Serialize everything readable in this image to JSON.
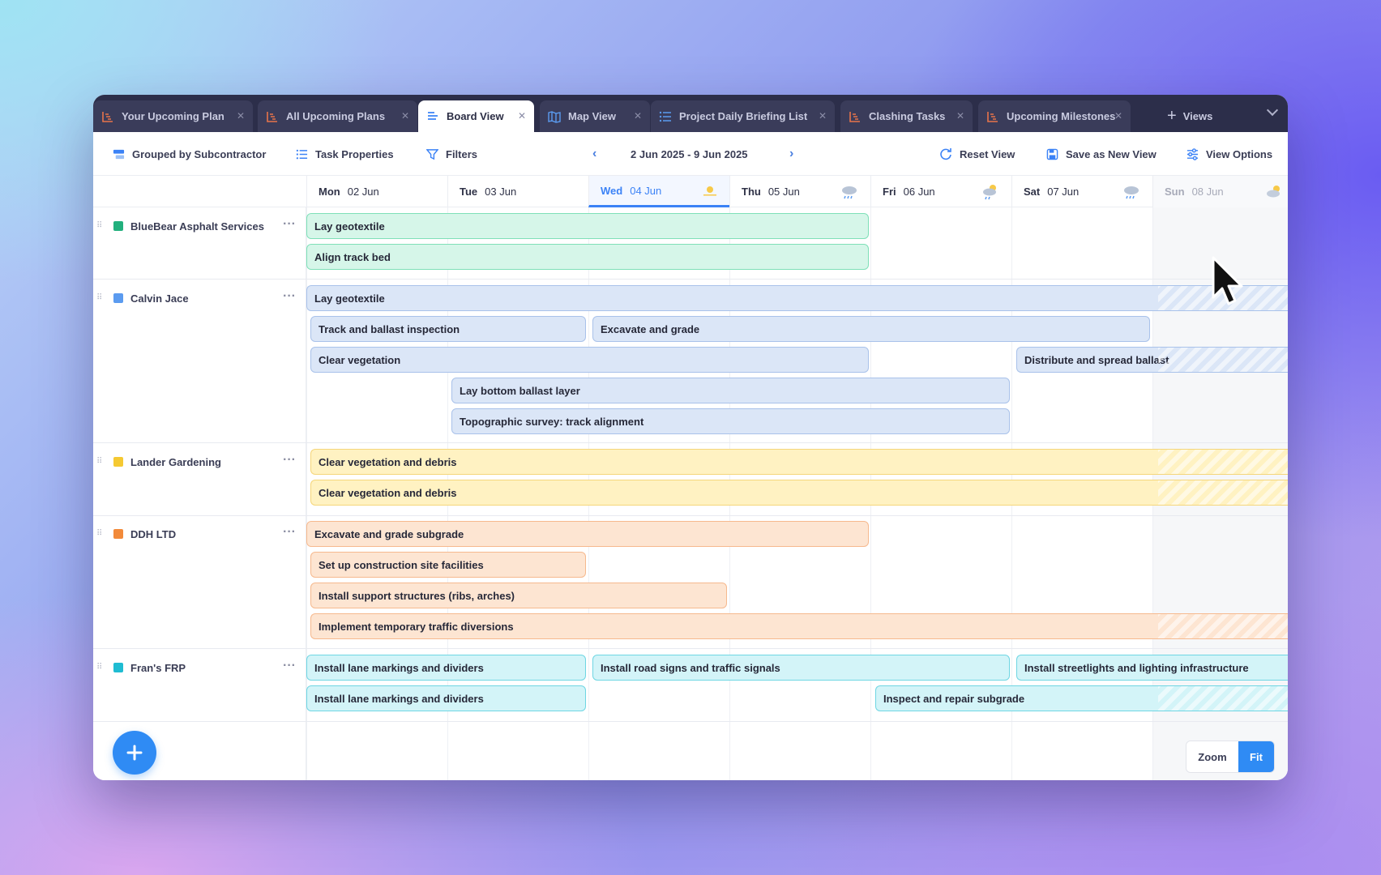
{
  "tabs": [
    {
      "label": "Your Upcoming Plan",
      "icon": "gantt-icon",
      "active": false
    },
    {
      "label": "All Upcoming Plans",
      "icon": "gantt-icon",
      "active": false
    },
    {
      "label": "Board View",
      "icon": "board-icon",
      "active": true
    },
    {
      "label": "Map View",
      "icon": "map-icon",
      "active": false
    },
    {
      "label": "Project Daily Briefing List",
      "icon": "list-icon",
      "active": false
    },
    {
      "label": "Clashing Tasks",
      "icon": "gantt-icon",
      "active": false
    },
    {
      "label": "Upcoming Milestones",
      "icon": "gantt-icon",
      "active": false
    }
  ],
  "views_label": "Views",
  "toolbar": {
    "grouped": "Grouped by Subcontractor",
    "task_properties": "Task Properties",
    "filters": "Filters",
    "date_range": "2 Jun 2025 - 9 Jun 2025",
    "reset_view": "Reset View",
    "save_view": "Save as New View",
    "view_options": "View Options"
  },
  "days": [
    {
      "dow": "Mon",
      "date": "02 Jun",
      "weather": ""
    },
    {
      "dow": "Tue",
      "date": "03 Jun",
      "weather": ""
    },
    {
      "dow": "Wed",
      "date": "04 Jun",
      "weather": "sun-icon",
      "today": true
    },
    {
      "dow": "Thu",
      "date": "05 Jun",
      "weather": "rain-cloud-icon"
    },
    {
      "dow": "Fri",
      "date": "06 Jun",
      "weather": "sun-cloud-rain-icon"
    },
    {
      "dow": "Sat",
      "date": "07 Jun",
      "weather": "rain-cloud-icon"
    },
    {
      "dow": "Sun",
      "date": "08 Jun",
      "weather": "sun-cloud-icon",
      "dim": true
    }
  ],
  "groups": [
    {
      "name": "BlueBear Asphalt Services",
      "color": "#22b07d",
      "tasks": [
        {
          "label": "Lay geotextile"
        },
        {
          "label": "Align track bed"
        }
      ]
    },
    {
      "name": "Calvin Jace",
      "color": "#5b9bf0",
      "tasks": [
        {
          "label": "Lay geotextile"
        },
        {
          "label": "Track and ballast inspection"
        },
        {
          "label": "Excavate and grade"
        },
        {
          "label": "Clear vegetation"
        },
        {
          "label": "Distribute and spread ballast"
        },
        {
          "label": "Lay bottom ballast layer"
        },
        {
          "label": "Topographic survey: track alignment"
        }
      ]
    },
    {
      "name": "Lander Gardening",
      "color": "#f5c932",
      "tasks": [
        {
          "label": "Clear vegetation and debris"
        },
        {
          "label": "Clear vegetation and debris"
        }
      ]
    },
    {
      "name": "DDH LTD",
      "color": "#f28a3a",
      "tasks": [
        {
          "label": "Excavate and grade subgrade"
        },
        {
          "label": "Set up construction site facilities"
        },
        {
          "label": "Install support structures (ribs, arches)"
        },
        {
          "label": "Implement temporary traffic diversions"
        }
      ]
    },
    {
      "name": "Fran's FRP",
      "color": "#1fbcd2",
      "tasks": [
        {
          "label": "Install lane markings and dividers"
        },
        {
          "label": "Install road signs and traffic signals"
        },
        {
          "label": "Install streetlights and lighting infrastructure"
        },
        {
          "label": "Install lane markings and dividers"
        },
        {
          "label": "Inspect and repair subgrade"
        }
      ]
    }
  ],
  "zoom_label": "Zoom",
  "fit_label": "Fit",
  "colors": {
    "accent": "#2f8bf4",
    "tabbar": "#2c2e4a"
  }
}
